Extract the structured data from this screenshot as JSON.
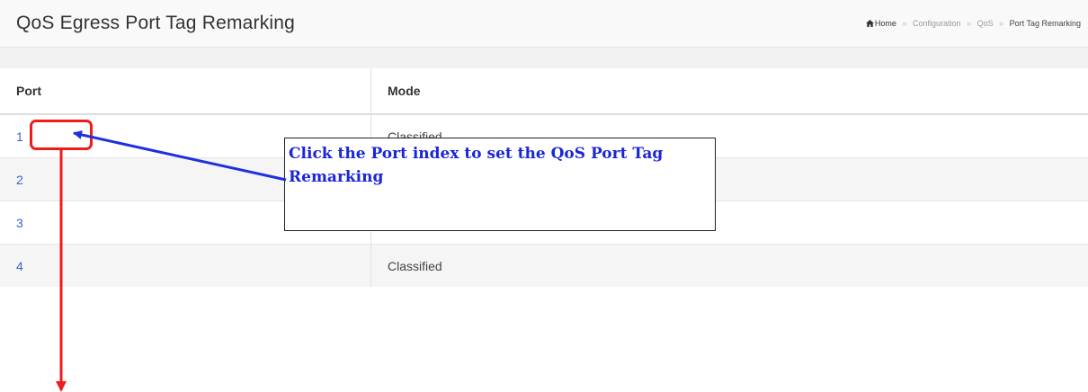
{
  "header": {
    "title": "QoS Egress Port Tag Remarking",
    "breadcrumb": {
      "home": "Home",
      "items": [
        "Configuration",
        "QoS"
      ],
      "current": "Port Tag Remarking",
      "separator": "»"
    }
  },
  "table": {
    "columns": [
      "Port",
      "Mode"
    ],
    "rows": [
      {
        "port": "1",
        "mode": "Classified"
      },
      {
        "port": "2",
        "mode": ""
      },
      {
        "port": "3",
        "mode": ""
      },
      {
        "port": "4",
        "mode": "Classified"
      }
    ]
  },
  "annotation": {
    "text": "Click the Port index to set the QoS Port Tag Remarking"
  },
  "colors": {
    "link": "#3a63c6",
    "callout_text": "#1a26d8",
    "blue_arrow": "#1f2fe0",
    "red_marker": "#ee1c1c"
  },
  "icons": {
    "home": "home-icon"
  }
}
